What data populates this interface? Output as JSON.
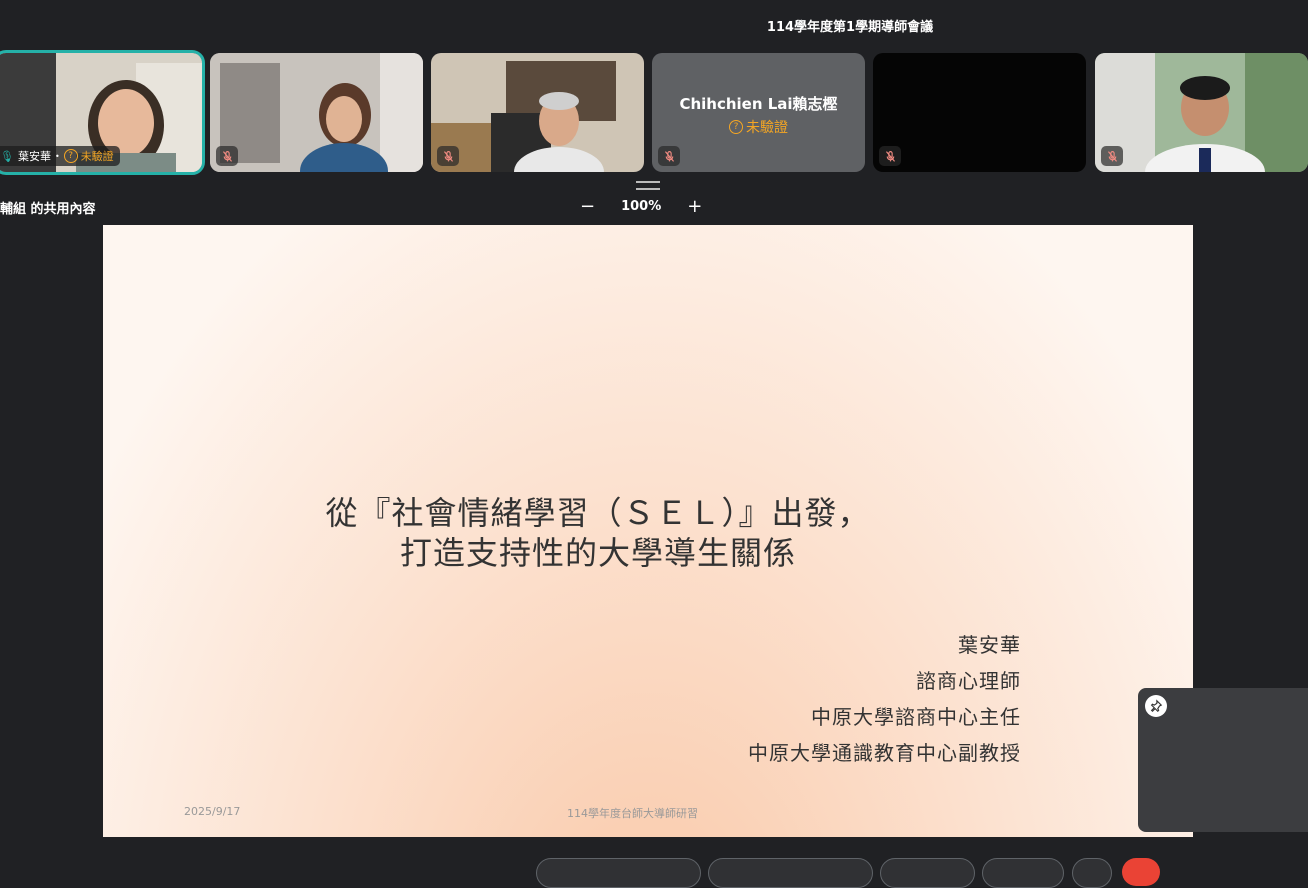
{
  "meeting": {
    "title": "114學年度第1學期導師會議"
  },
  "participants": [
    {
      "name": "葉安華",
      "status": "未驗證",
      "speaking": true
    },
    {
      "name": "",
      "muted": true
    },
    {
      "name": "",
      "muted": true
    },
    {
      "name": "Chihchien Lai賴志樫",
      "status": "未驗證",
      "muted": true
    },
    {
      "name": "",
      "muted": true
    },
    {
      "name": "",
      "muted": true
    }
  ],
  "share": {
    "label": "生輔組 的共用內容",
    "zoom": "100%",
    "zoom_out": "−",
    "zoom_in": "+"
  },
  "slide": {
    "title_line1": "從『社會情緒學習（ＳＥＬ）』出發，",
    "title_line2": "打造支持性的大學導生關係",
    "author_lines": [
      "葉安華",
      "諮商心理師",
      "中原大學諮商中心主任",
      "中原大學通識教育中心副教授"
    ],
    "date": "2025/9/17",
    "footer": "114學年度台師大導師研習"
  },
  "colors": {
    "accent": "#25b1a8",
    "unverified": "#f5a623",
    "hangup": "#ea4335"
  }
}
